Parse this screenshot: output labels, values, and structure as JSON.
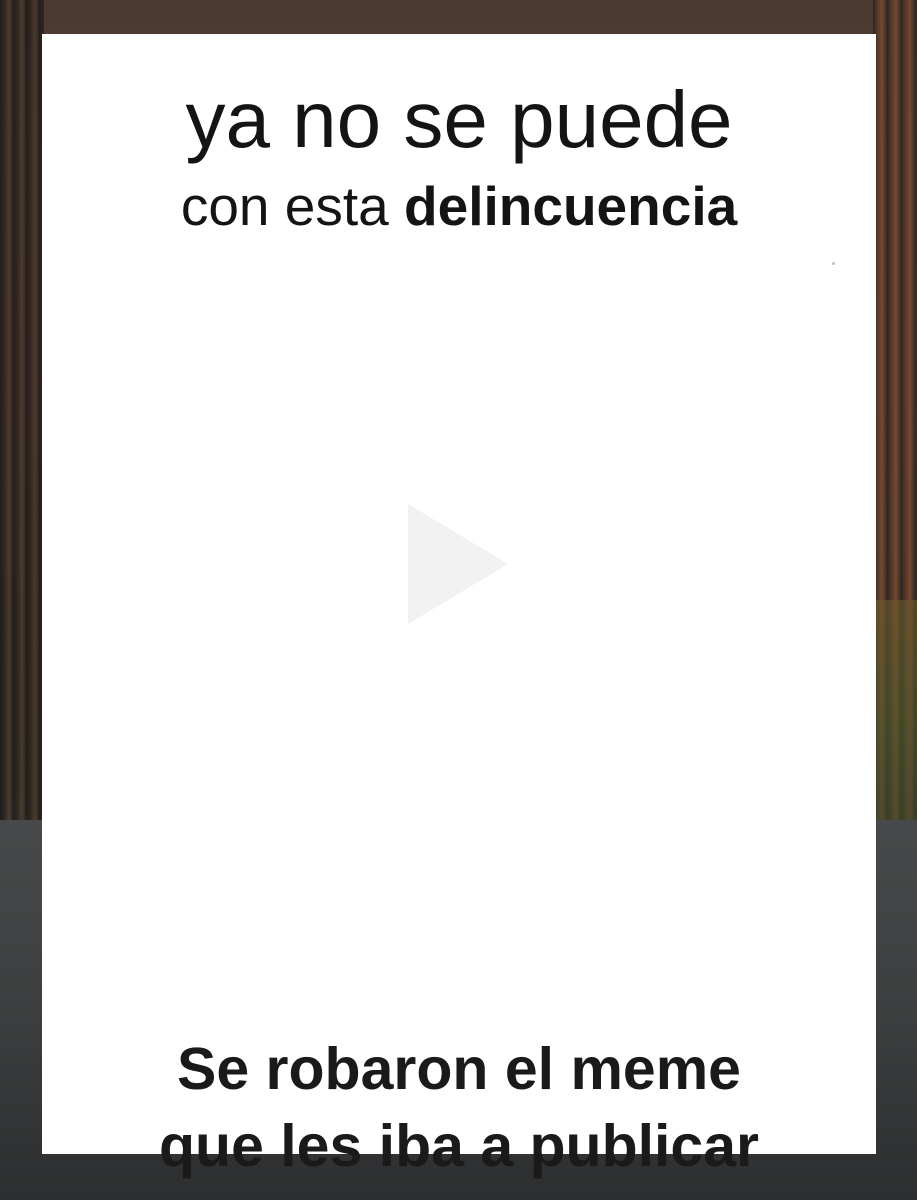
{
  "meme": {
    "top_line1": "ya no se puede",
    "top_line2_regular": "con esta ",
    "top_line2_bold": "delincuencia",
    "bottom_line1": "Se robaron el meme",
    "bottom_line2": "que les iba a publicar"
  }
}
